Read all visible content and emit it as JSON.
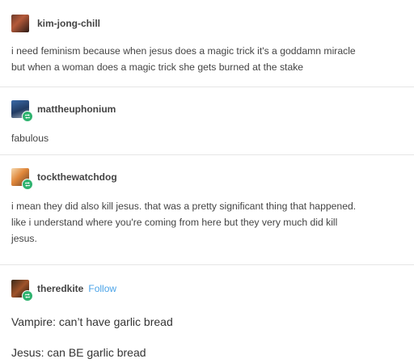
{
  "colors": {
    "reblog_badge": "#2fb36f",
    "follow_link": "#4aa3e8"
  },
  "posts": [
    {
      "username": "kim-jong-chill",
      "avatar_icon": "user-avatar-icon",
      "lines": [
        "i need feminism because when jesus does a magic trick it's a goddamn miracle",
        "but when a woman does a magic trick she gets burned at the stake"
      ]
    },
    {
      "username": "mattheuphonium",
      "avatar_icon": "user-avatar-icon",
      "lines": [
        "fabulous"
      ]
    },
    {
      "username": "tockthewatchdog",
      "avatar_icon": "user-avatar-icon",
      "lines": [
        "i mean they did also kill jesus. that was a pretty significant thing that happened.",
        "like i understand where you're coming from here but they very much did kill",
        "jesus."
      ]
    },
    {
      "username": "theredkite",
      "follow_label": "Follow",
      "avatar_icon": "user-avatar-icon",
      "paragraphs": [
        "Vampire: can’t have garlic bread",
        "Jesus: can BE garlic bread"
      ]
    }
  ]
}
